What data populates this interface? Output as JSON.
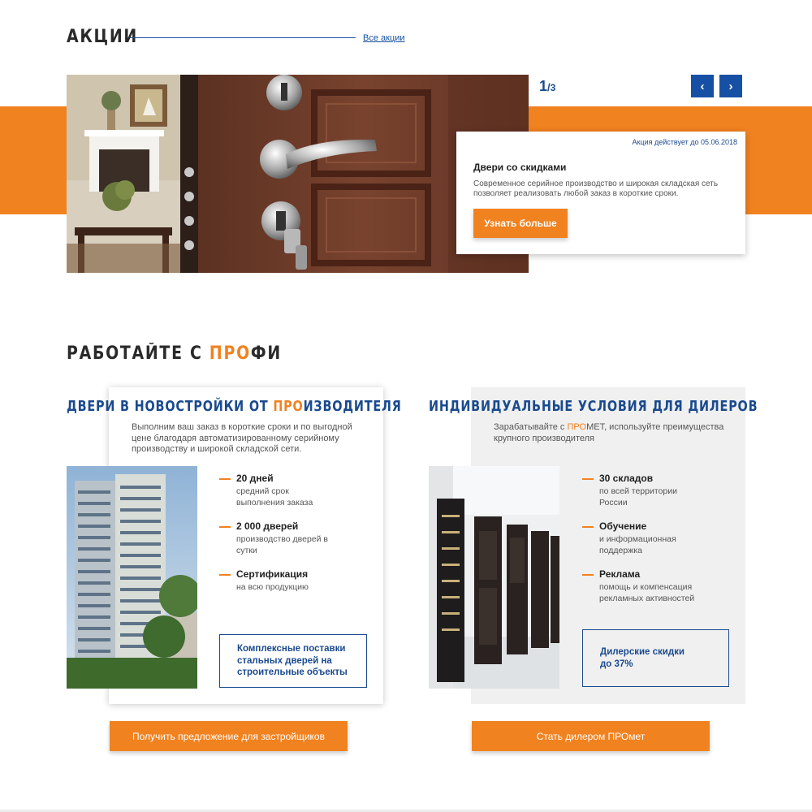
{
  "promotions": {
    "title": "АКЦИИ",
    "all_link": "Все акции",
    "counter": {
      "current": "1",
      "separator": "/",
      "total": "3"
    },
    "card": {
      "valid_until": "Акция действует до 05.06.2018",
      "heading": "Двери со скидками",
      "description": "Современное серийное производство и широкая складская сеть позволяет реализовать любой заказ в короткие сроки.",
      "button": "Узнать больше"
    },
    "prev_icon": "‹",
    "next_icon": "›"
  },
  "pro_section": {
    "title_before": "РАБОТАЙТЕ С ",
    "title_accent": "ПРО",
    "title_after": "ФИ",
    "builders": {
      "title_before": "ДВЕРИ В НОВОСТРОЙКИ ОТ ",
      "title_accent": "ПРО",
      "title_after": "ИЗВОДИТЕЛЯ",
      "description": "Выполним ваш заказ в короткие сроки и по выгодной цене благодаря автоматизированному серийному производству и широкой складской сети.",
      "features": [
        {
          "title": "20 дней",
          "subtitle": "средний срок выполнения заказа"
        },
        {
          "title": "2 000 дверей",
          "subtitle": "производство дверей в сутки"
        },
        {
          "title": "Сертификация",
          "subtitle": "на всю продукцию"
        }
      ],
      "box_text": "Комплексные поставки стальных дверей на строительные объекты",
      "button": "Получить предложение для застройщиков"
    },
    "dealers": {
      "title": "ИНДИВИДУАЛЬНЫЕ УСЛОВИЯ ДЛЯ ДИЛЕРОВ",
      "description_before": "Зарабатывайте с ",
      "description_accent": "ПРО",
      "description_after": "МЕТ, используйте преимущества крупного производителя",
      "features": [
        {
          "title": "30 складов",
          "subtitle": "по всей территории России"
        },
        {
          "title": "Обучение",
          "subtitle": "и информационная поддержка"
        },
        {
          "title": "Реклама",
          "subtitle": "помощь и компенсация рекламных активностей"
        }
      ],
      "box_text": "Дилерские скидки до 37%",
      "button": "Стать дилером ПРОмет"
    }
  },
  "colors": {
    "accent": "#f18220",
    "brand_blue": "#1650a5",
    "text_dark": "#222222"
  }
}
